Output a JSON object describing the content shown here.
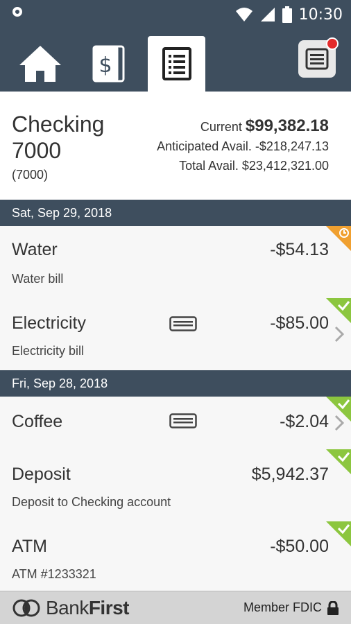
{
  "status": {
    "time": "10:30"
  },
  "account": {
    "name": "Checking 7000",
    "number": "(7000)",
    "current_label": "Current",
    "current_value": "$99,382.18",
    "anticipated": "Anticipated Avail. -$218,247.13",
    "total": "Total Avail. $23,412,321.00"
  },
  "groups": [
    {
      "date": "Sat, Sep 29, 2018",
      "transactions": [
        {
          "title": "Water",
          "amount": "-$54.13",
          "desc": "Water bill",
          "status": "pending",
          "card_icon": false,
          "chevron": false
        },
        {
          "title": "Electricity",
          "amount": "-$85.00",
          "desc": "Electricity bill",
          "status": "cleared",
          "card_icon": true,
          "chevron": true
        }
      ]
    },
    {
      "date": "Fri, Sep 28, 2018",
      "transactions": [
        {
          "title": "Coffee",
          "amount": "-$2.04",
          "desc": "",
          "status": "cleared",
          "card_icon": true,
          "chevron": true
        },
        {
          "title": "Deposit",
          "amount": "$5,942.37",
          "desc": "Deposit to Checking account",
          "status": "cleared",
          "card_icon": false,
          "chevron": false
        },
        {
          "title": "ATM",
          "amount": "-$50.00",
          "desc": "ATM #1233321",
          "status": "cleared",
          "card_icon": false,
          "chevron": false
        }
      ]
    }
  ],
  "footer": {
    "brand_plain": "Bank",
    "brand_bold": "First",
    "fdic": "Member FDIC"
  },
  "colors": {
    "header_bg": "#3e4e5e",
    "cleared": "#8cc63f",
    "pending": "#f0a030",
    "notification": "#e32b2b"
  },
  "icons": [
    "home-icon",
    "dollar-bill-icon",
    "statement-icon",
    "menu-icon",
    "card-icon",
    "chevron-right-icon",
    "check-icon",
    "clock-icon",
    "lock-icon"
  ]
}
